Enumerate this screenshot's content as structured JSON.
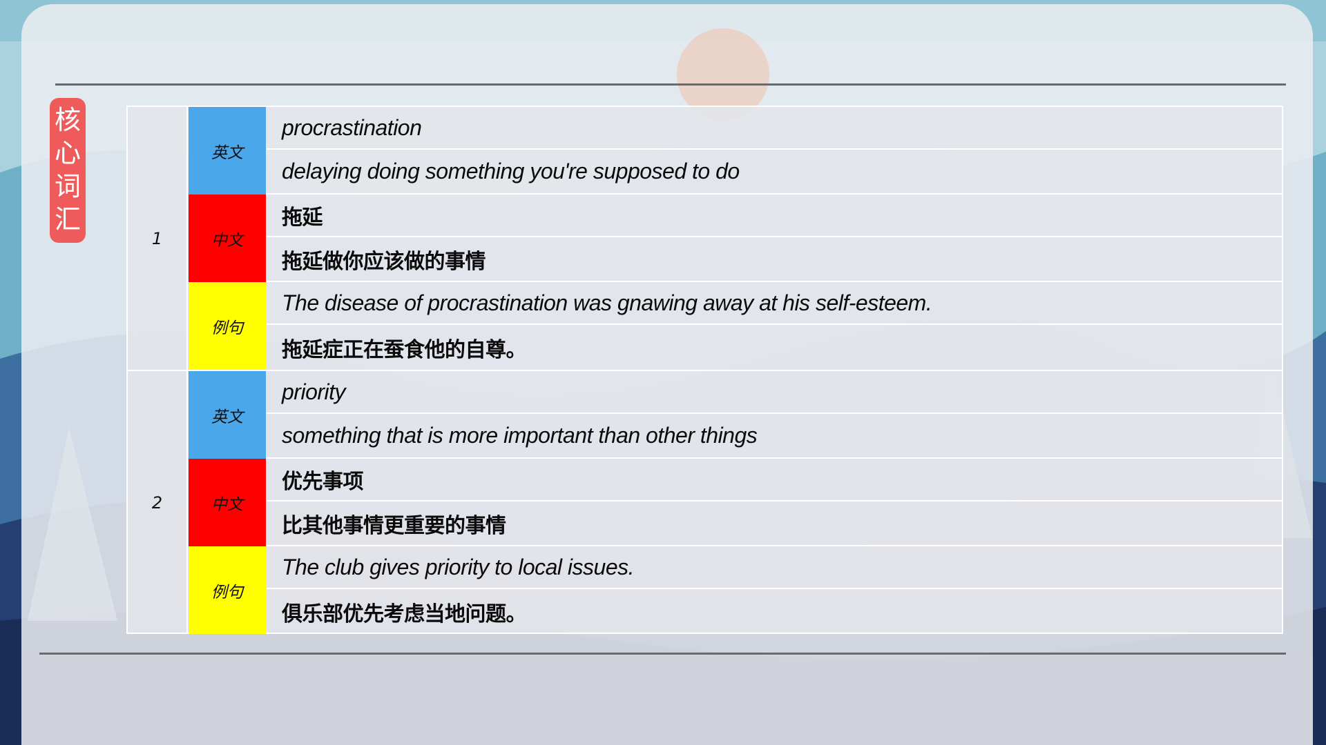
{
  "section_label": "核心词汇",
  "colors": {
    "english_tag": "#4aa7ea",
    "chinese_tag": "#ff0000",
    "example_tag": "#ffff00",
    "section_tag": "#ef5b5b"
  },
  "entries": [
    {
      "index": "1",
      "english_label": "英文",
      "chinese_label": "中文",
      "example_label": "例句",
      "word": "procrastination",
      "definition": "delaying doing something you're supposed to do",
      "chinese_word": "拖延",
      "chinese_definition": "拖延做你应该做的事情",
      "example_en": "The disease of procrastination was gnawing away at his self-esteem.",
      "example_cn": "拖延症正在蚕食他的自尊。"
    },
    {
      "index": "2",
      "english_label": "英文",
      "chinese_label": "中文",
      "example_label": "例句",
      "word": "priority",
      "definition": "something that is more important than other things",
      "chinese_word": "优先事项",
      "chinese_definition": "比其他事情更重要的事情",
      "example_en": "The club gives priority to local issues.",
      "example_cn": "俱乐部优先考虑当地问题。"
    }
  ]
}
